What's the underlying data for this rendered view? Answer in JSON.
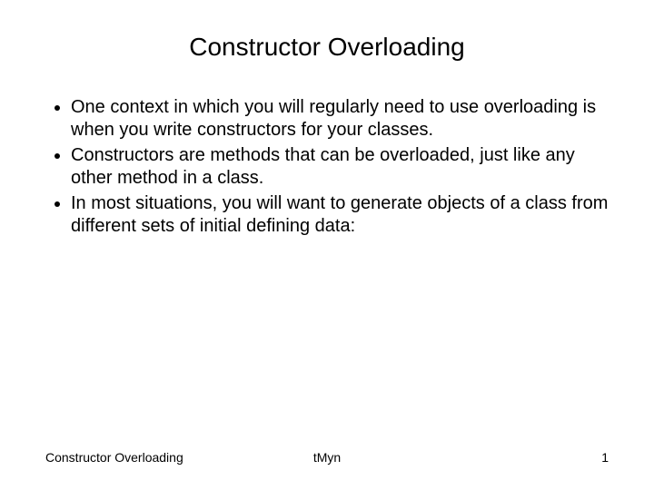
{
  "slide": {
    "title": "Constructor Overloading",
    "bullets": [
      "One context in which you will regularly need to use overloading is when you write constructors for your classes.",
      "Constructors are methods that can be overloaded, just like any other method in a class.",
      "In most situations, you will want to generate objects of a class from different sets of initial defining data:"
    ]
  },
  "footer": {
    "left": "Constructor Overloading",
    "center": "tMyn",
    "right": "1"
  }
}
